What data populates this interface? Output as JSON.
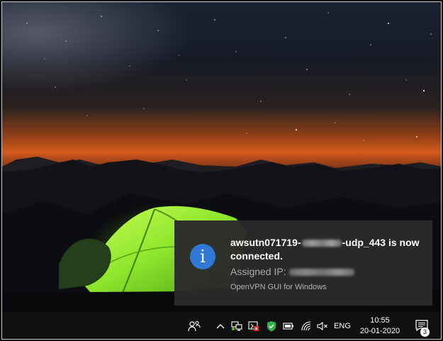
{
  "notification": {
    "title_prefix": "awsutn071719-",
    "title_suffix": "-udp_443 is now connected.",
    "ip_label": "Assigned IP:",
    "app_name": "OpenVPN GUI for Windows",
    "icon": "info-icon",
    "accent": "#2f78d6"
  },
  "taskbar": {
    "language": "ENG",
    "time": "10:55",
    "date": "20-01-2020",
    "notification_count": "3",
    "tray_icons": [
      "people-icon",
      "show-hidden-icons-chevron",
      "network-icon",
      "openvpn-icon",
      "security-shield-icon",
      "battery-icon",
      "wifi-icon",
      "volume-muted-icon",
      "action-center-icon"
    ]
  },
  "wallpaper": {
    "sky_top": "#0d1424",
    "horizon_glow": "#d35a1e",
    "tent_color": "#7ed321"
  }
}
